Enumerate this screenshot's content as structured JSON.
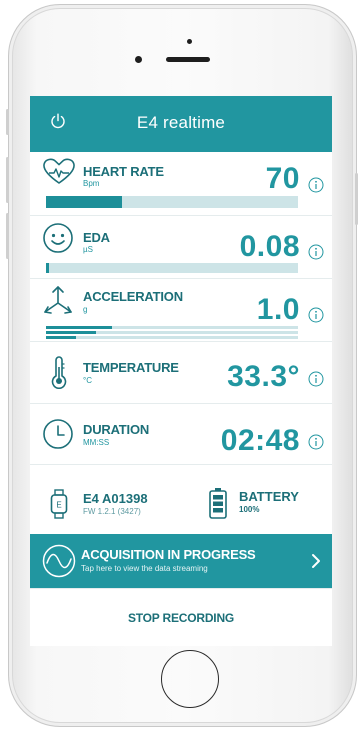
{
  "app": {
    "title": "E4 realtime"
  },
  "metrics": [
    {
      "label": "HEART RATE",
      "unit": "Bpm",
      "value": "70",
      "icon": "heart-icon",
      "bar_level": 0.3
    },
    {
      "label": "EDA",
      "unit": "µS",
      "value": "0.08",
      "icon": "eda-face-icon",
      "bar_level": 0.01
    },
    {
      "label": "ACCELERATION",
      "unit": "g",
      "value": "1.0",
      "icon": "acceleration-icon",
      "bar_levels": [
        0.26,
        0.2,
        0.12
      ]
    },
    {
      "label": "TEMPERATURE",
      "unit": "°C",
      "value": "33.3°",
      "icon": "thermometer-icon"
    },
    {
      "label": "DURATION",
      "unit": "MM:SS",
      "value": "02:48",
      "icon": "clock-icon"
    }
  ],
  "device": {
    "name": "E4 A01398",
    "firmware": "FW 1.2.1 (3427)",
    "icon": "watch-icon"
  },
  "battery": {
    "label": "BATTERY",
    "level": "100%",
    "icon": "battery-icon"
  },
  "acquisition": {
    "title": "ACQUISITION IN PROGRESS",
    "subtitle": "Tap here to view the data streaming"
  },
  "actions": {
    "stop_label": "STOP RECORDING"
  },
  "colors": {
    "accent": "#2196a0",
    "dark_text": "#1c6f78",
    "bar_track": "#cde4e7"
  }
}
